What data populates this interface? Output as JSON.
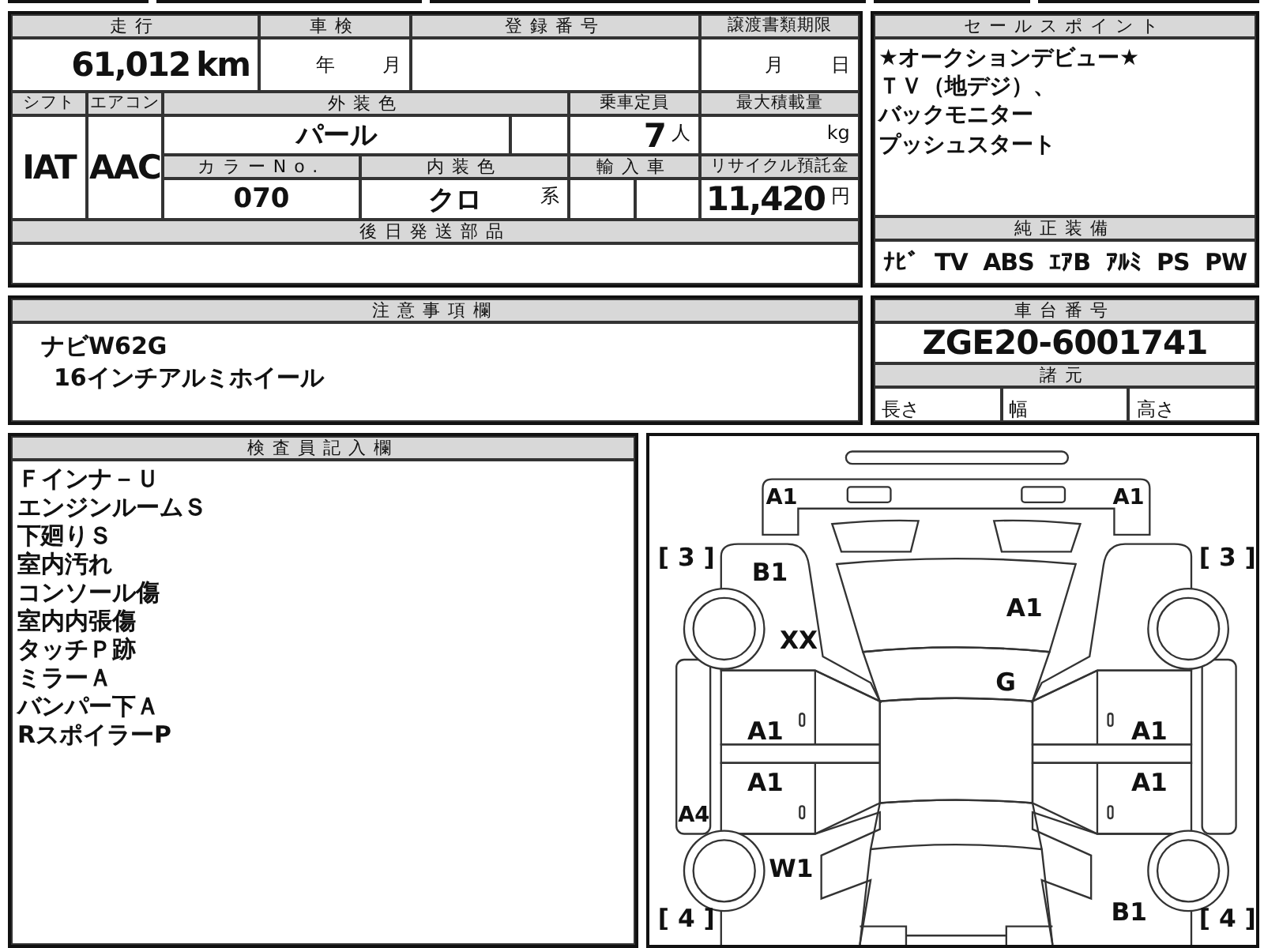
{
  "top_table": {
    "mileage": {
      "label": "走行",
      "value": "61,012",
      "unit": "km"
    },
    "inspection": {
      "label": "車検",
      "year_unit": "年",
      "month_unit": "月"
    },
    "registration": {
      "label": "登録番号"
    },
    "document_deadline": {
      "label": "譲渡書類期限",
      "month_unit": "月",
      "day_unit": "日"
    },
    "shift": {
      "label": "シフト",
      "value": "IAT"
    },
    "aircon": {
      "label": "エアコン",
      "value": "AAC"
    },
    "exterior_color": {
      "label": "外装色",
      "value": "パール"
    },
    "capacity": {
      "label": "乗車定員",
      "value": "7",
      "unit": "人"
    },
    "max_load": {
      "label": "最大積載量",
      "unit": "kg"
    },
    "color_no": {
      "label": "カラーNo.",
      "value": "070"
    },
    "interior_color": {
      "label": "内装色",
      "value": "クロ",
      "suffix": "系"
    },
    "import_car": {
      "label": "輸入車"
    },
    "recycle_fee": {
      "label": "リサイクル預託金",
      "value": "11,420",
      "unit": "円"
    },
    "parts_later": {
      "label": "後日発送部品"
    }
  },
  "sale_points": {
    "label": "セールスポイント",
    "lines": [
      "★オークションデビュー★",
      "ＴＶ（地デジ）、",
      "バックモニター",
      "プッシュスタート"
    ]
  },
  "equipment": {
    "label": "純正装備",
    "items": [
      "ﾅﾋﾞ",
      "TV",
      "ABS",
      "ｴｱB",
      "ｱﾙﾐ",
      "PS",
      "PW"
    ]
  },
  "notes": {
    "label": "注意事項欄",
    "lines": [
      "ナビW62G",
      "16インチアルミホイール"
    ]
  },
  "chassis": {
    "label": "車台番号",
    "value": "ZGE20-6001741"
  },
  "specs": {
    "label": "諸元",
    "cells": [
      "長さ",
      "幅",
      "高さ"
    ]
  },
  "inspector": {
    "label": "検査員記入欄",
    "lines": [
      "Ｆインナ－Ｕ",
      "エンジンルームＳ",
      "下廻りＳ",
      "室内汚れ",
      "コンソール傷",
      "室内内張傷",
      "タッチＰ跡",
      "ミラーＡ",
      "バンパー下Ａ",
      "RスポイラーP"
    ]
  },
  "diagram_marks": [
    {
      "kind": "front-left",
      "text": "A1"
    },
    {
      "kind": "front-right",
      "text": "A1"
    },
    {
      "kind": "tire-fl",
      "text": "[ 3 ]"
    },
    {
      "kind": "tire-fr",
      "text": "[ 3 ]"
    },
    {
      "kind": "fender-fl",
      "text": "B1"
    },
    {
      "kind": "hood",
      "text": "A1"
    },
    {
      "kind": "fender-fl-low",
      "text": "XX"
    },
    {
      "kind": "windshield",
      "text": "G"
    },
    {
      "kind": "door-fl",
      "text": "A1"
    },
    {
      "kind": "door-fr",
      "text": "A1"
    },
    {
      "kind": "door-rl",
      "text": "A1"
    },
    {
      "kind": "door-rr",
      "text": "A1"
    },
    {
      "kind": "sill-left",
      "text": "A4"
    },
    {
      "kind": "quarter-rl",
      "text": "W1"
    },
    {
      "kind": "tire-rl",
      "text": "[ 4 ]"
    },
    {
      "kind": "quarter-rr",
      "text": "B1"
    },
    {
      "kind": "tire-rr",
      "text": "[ 4 ]"
    }
  ]
}
